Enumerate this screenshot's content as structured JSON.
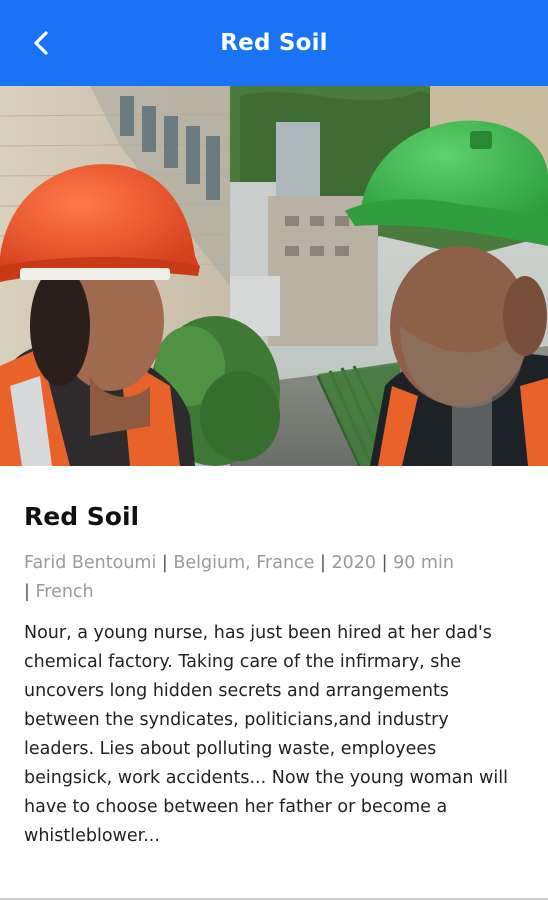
{
  "header": {
    "title": "Red Soil",
    "back_icon": "chevron-left-icon",
    "background_color": "#1a73f5"
  },
  "hero": {
    "alt": "Two workers in hard hats, one orange and one green, talking at a factory site"
  },
  "movie": {
    "title": "Red Soil",
    "director": "Farid Bentoumi",
    "countries": "Belgium, France",
    "year": "2020",
    "duration": "90 min",
    "language": "French",
    "synopsis": "Nour, a young nurse, has just been hired at her dad's chemical factory. Taking care of the infirmary, she uncovers long hidden secrets and arrangements between the syndicates, politicians,and industry leaders. Lies about polluting waste, employees beingsick, work accidents... Now the young woman will have to choose between her father or become a whistleblower..."
  }
}
